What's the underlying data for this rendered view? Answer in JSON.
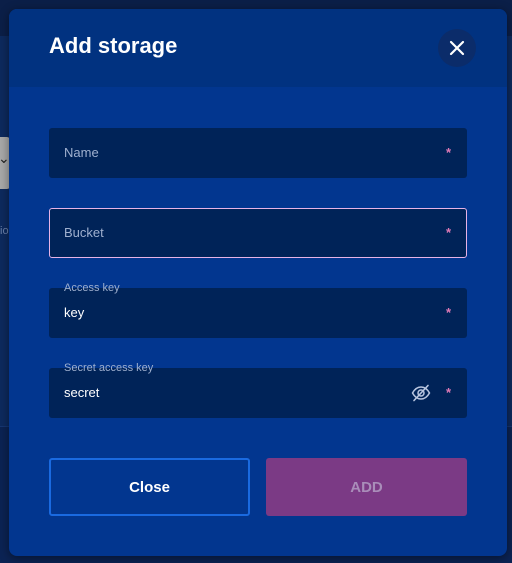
{
  "background": {
    "partial_text": "io"
  },
  "modal": {
    "title": "Add storage",
    "fields": [
      {
        "placeholder": "Name",
        "required_marker": "*"
      },
      {
        "placeholder": "Bucket",
        "required_marker": "*"
      },
      {
        "label": "Access key",
        "value": "key",
        "required_marker": "*"
      },
      {
        "label": "Secret access key",
        "value": "secret",
        "required_marker": "*"
      }
    ],
    "buttons": {
      "close_label": "Close",
      "add_label": "ADD"
    }
  },
  "colors": {
    "modal_bg": "#02368f",
    "field_bg": "#002358",
    "focus_border": "#e6b3e6",
    "required_marker": "#e07ab6",
    "close_border": "#1a6ae0",
    "add_button_bg": "#7b3a85"
  },
  "icons": {
    "close": "close-icon",
    "visibility": "eye-off-icon"
  }
}
